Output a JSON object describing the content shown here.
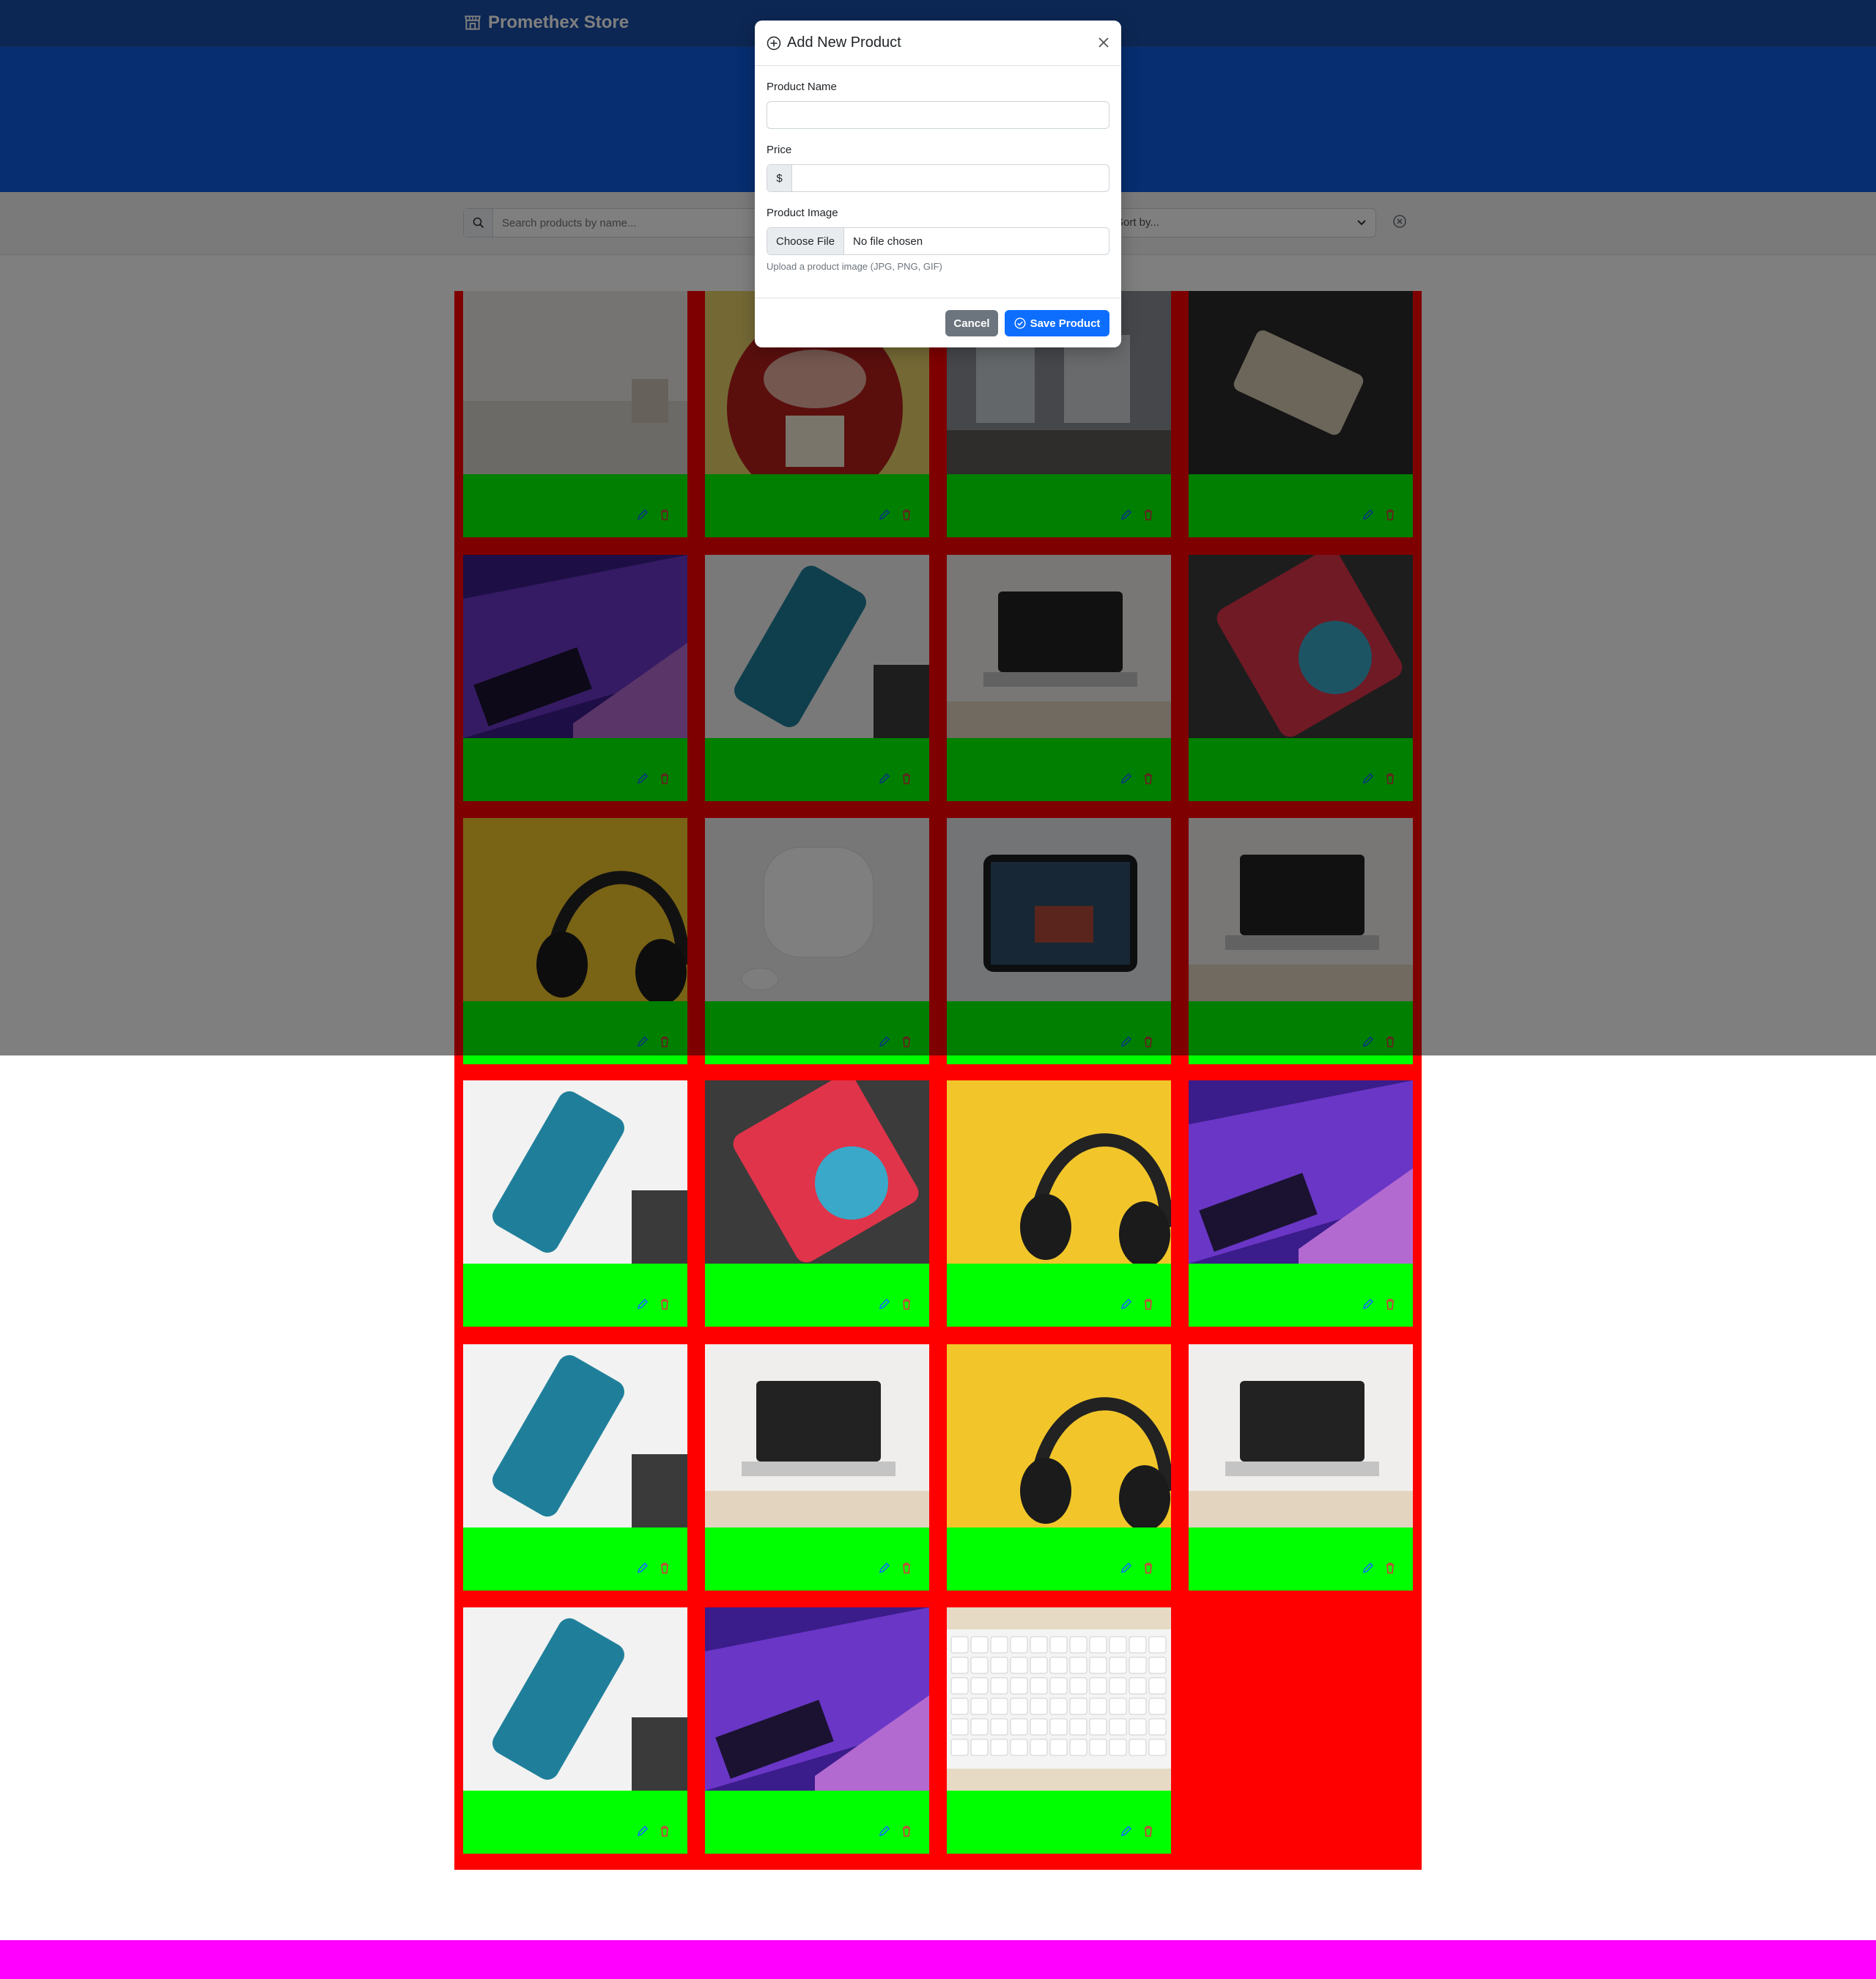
{
  "brand": {
    "name": "Promethex Store"
  },
  "filters": {
    "search_placeholder": "Search products by name...",
    "sort_label": "Sort by..."
  },
  "products": [
    {
      "image": "blurred-room-photo"
    },
    {
      "image": "red-toy-photo"
    },
    {
      "image": "window-interior-photo"
    },
    {
      "image": "phone-box-photo"
    },
    {
      "image": "laptop-purple-photo"
    },
    {
      "image": "iphone-photo"
    },
    {
      "image": "macbook-desk-photo"
    },
    {
      "image": "ipad-photo"
    },
    {
      "image": "headphones-yellow-photo"
    },
    {
      "image": "airpods-photo"
    },
    {
      "image": "tablet-hand-photo"
    },
    {
      "image": "macbook-desk-photo"
    },
    {
      "image": "iphone-photo"
    },
    {
      "image": "ipad-photo"
    },
    {
      "image": "headphones-yellow-photo"
    },
    {
      "image": "laptop-purple-photo"
    },
    {
      "image": "iphone-photo"
    },
    {
      "image": "macbook-desk-photo"
    },
    {
      "image": "headphones-yellow-photo"
    },
    {
      "image": "macbook-desk-photo"
    },
    {
      "image": "iphone-photo"
    },
    {
      "image": "laptop-purple-photo"
    },
    {
      "image": "keyboard-photo"
    }
  ],
  "modal": {
    "title": "Add New Product",
    "name_label": "Product Name",
    "price_label": "Price",
    "currency": "$",
    "image_label": "Product Image",
    "choose_file": "Choose File",
    "no_file": "No file chosen",
    "hint": "Upload a product image (JPG, PNG, GIF)",
    "cancel": "Cancel",
    "save": "Save Product"
  },
  "colors": {
    "navbar": "#1a4fa8",
    "hero": "#0d5ce0",
    "grid_bg": "#ff0000",
    "card_body": "#00ff00",
    "footer": "#ff00ff",
    "primary": "#0d6efd",
    "secondary": "#6c757d"
  }
}
